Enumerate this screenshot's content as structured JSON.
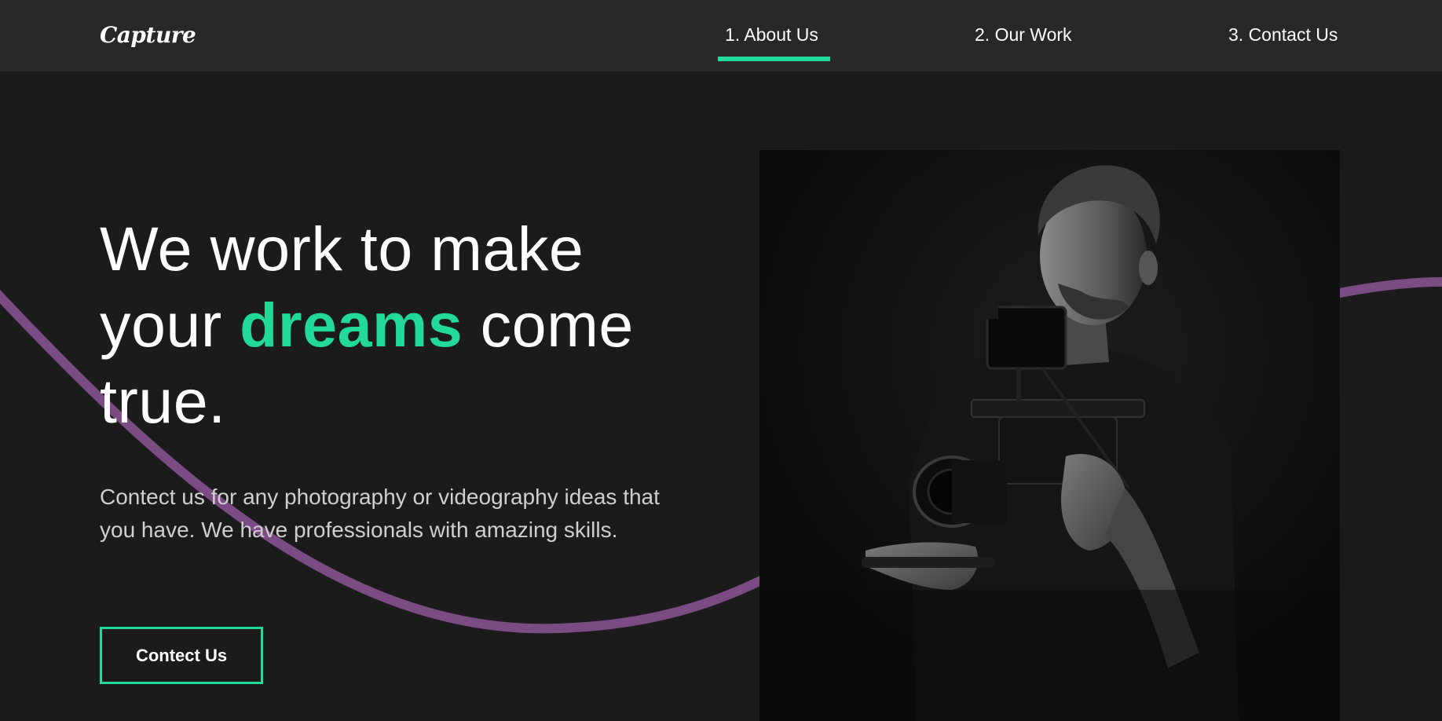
{
  "brand": {
    "logo_text": "Capture"
  },
  "nav": {
    "items": [
      {
        "label": "1. About Us",
        "active": true
      },
      {
        "label": "2. Our Work",
        "active": false
      },
      {
        "label": "3. Contact Us",
        "active": false
      }
    ]
  },
  "hero": {
    "title_part1": "We work to make",
    "title_part2": "your ",
    "title_highlight": "dreams",
    "title_part3": " come",
    "title_part4": "true.",
    "description": "Contect us for any photography or videography ideas that you have. We have professionals with amazing skills.",
    "cta_label": "Contect Us"
  },
  "colors": {
    "background": "#1b1b1b",
    "navbar": "#282828",
    "accent": "#23d997",
    "wave": "#7b4c84"
  },
  "image": {
    "subject": "black-and-white photo of a videographer holding a camera rig"
  }
}
